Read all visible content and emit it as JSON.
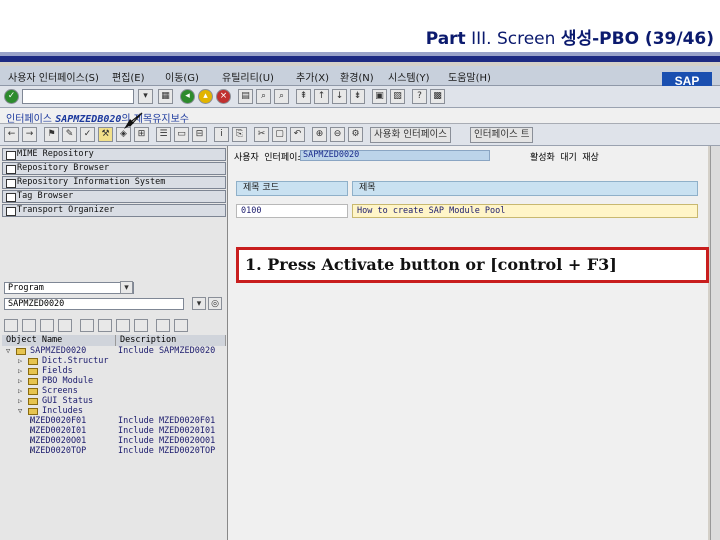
{
  "slide": {
    "title_bold_1": "Part",
    "title_regular": "III. Screen ",
    "title_bold_2": "생성-PBO (39/46)"
  },
  "menubar": {
    "items": [
      "사용자 인터페이스(S)",
      "편집(E)",
      "이동(G)",
      "유틸리티(U)",
      "추가(X)",
      "환경(N)",
      "시스템(Y)",
      "도움말(H)"
    ],
    "logo": "SAP"
  },
  "title_bar": {
    "prefix": "인터페이스",
    "program": "SAPMZEDB020",
    "suffix": "의 제목유지보수"
  },
  "toolbar2": {
    "buttons": [
      "사용화 인터페이스",
      "인터페이스 트"
    ]
  },
  "nav": {
    "buttons": [
      "MIME Repository",
      "Repository Browser",
      "Repository Information System",
      "Tag Browser",
      "Transport Organizer"
    ],
    "object_type": "Program",
    "object_name": "SAPMZED0020",
    "columns": {
      "object_name": "Object Name",
      "description": "Description"
    },
    "tree": [
      {
        "name": "SAPMZED0020",
        "desc": "Include SAPMZED0020",
        "indent": 0,
        "expanded": true
      },
      {
        "name": "Dict.Structur",
        "desc": "",
        "indent": 1,
        "expanded": false
      },
      {
        "name": "Fields",
        "desc": "",
        "indent": 1,
        "expanded": false
      },
      {
        "name": "PBO Module",
        "desc": "",
        "indent": 1,
        "expanded": false
      },
      {
        "name": "Screens",
        "desc": "",
        "indent": 1,
        "expanded": false
      },
      {
        "name": "GUI Status",
        "desc": "",
        "indent": 1,
        "expanded": false
      },
      {
        "name": "Includes",
        "desc": "",
        "indent": 1,
        "expanded": true
      },
      {
        "name": "MZED0020F01",
        "desc": "Include MZED0020F01",
        "indent": 2,
        "expanded": false
      },
      {
        "name": "MZED0020I01",
        "desc": "Include MZED0020I01",
        "indent": 2,
        "expanded": false
      },
      {
        "name": "MZED0020O01",
        "desc": "Include MZED0020O01",
        "indent": 2,
        "expanded": false
      },
      {
        "name": "MZED0020TOP",
        "desc": "Include MZED0020TOP",
        "indent": 2,
        "expanded": false
      }
    ]
  },
  "content": {
    "ui_label": "사용자 인터페이스",
    "program_value": "SAPMZED0020",
    "status_label": "활성화 대기 재상",
    "grid_headers": [
      "제목 코드",
      "제목"
    ],
    "grid_row": {
      "code": "0100",
      "title": "How to create SAP Module Pool"
    }
  },
  "callout": {
    "text": "1. Press Activate button or [control + F3]"
  },
  "colors": {
    "callout_border": "#c81e1e",
    "title_text": "#0b1a6e",
    "field_blue": "#bcd4ea",
    "highlight_yellow": "#fff5c8"
  }
}
